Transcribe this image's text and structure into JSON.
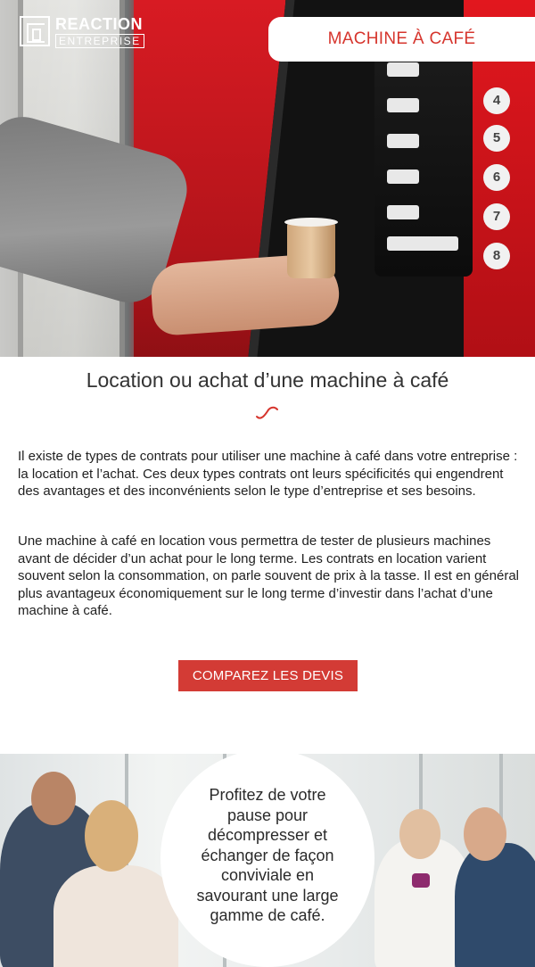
{
  "logo": {
    "line1": "REACTION",
    "line2": "ENTREPRISE"
  },
  "hero": {
    "badge": "MACHINE À CAFÉ",
    "buttons": [
      "4",
      "5",
      "6",
      "7",
      "8"
    ]
  },
  "content": {
    "title": "Location ou achat d’une machine à café",
    "paragraph1": "Il existe de types de contrats pour utiliser une machine à café dans votre entreprise : la location et l’achat. Ces deux types contrats ont leurs spécificités qui engendrent des avantages et des inconvénients selon le type d’entreprise et ses besoins.",
    "paragraph2": "Une machine à café en location vous permettra de tester de plusieurs machines avant de décider d’un achat pour le long terme. Les contrats en location varient souvent selon la consommation, on parle souvent de prix à la tasse. Il est en général plus avantageux économiquement sur le long terme d’investir dans l’achat d’une machine à café.",
    "cta": "COMPAREZ LES DEVIS"
  },
  "bottom": {
    "bubble": "Profitez de votre pause pour décompresser et échanger de façon conviviale en savourant une large gamme de café."
  },
  "colors": {
    "accent": "#d33b35",
    "badge_text": "#d6352d"
  }
}
